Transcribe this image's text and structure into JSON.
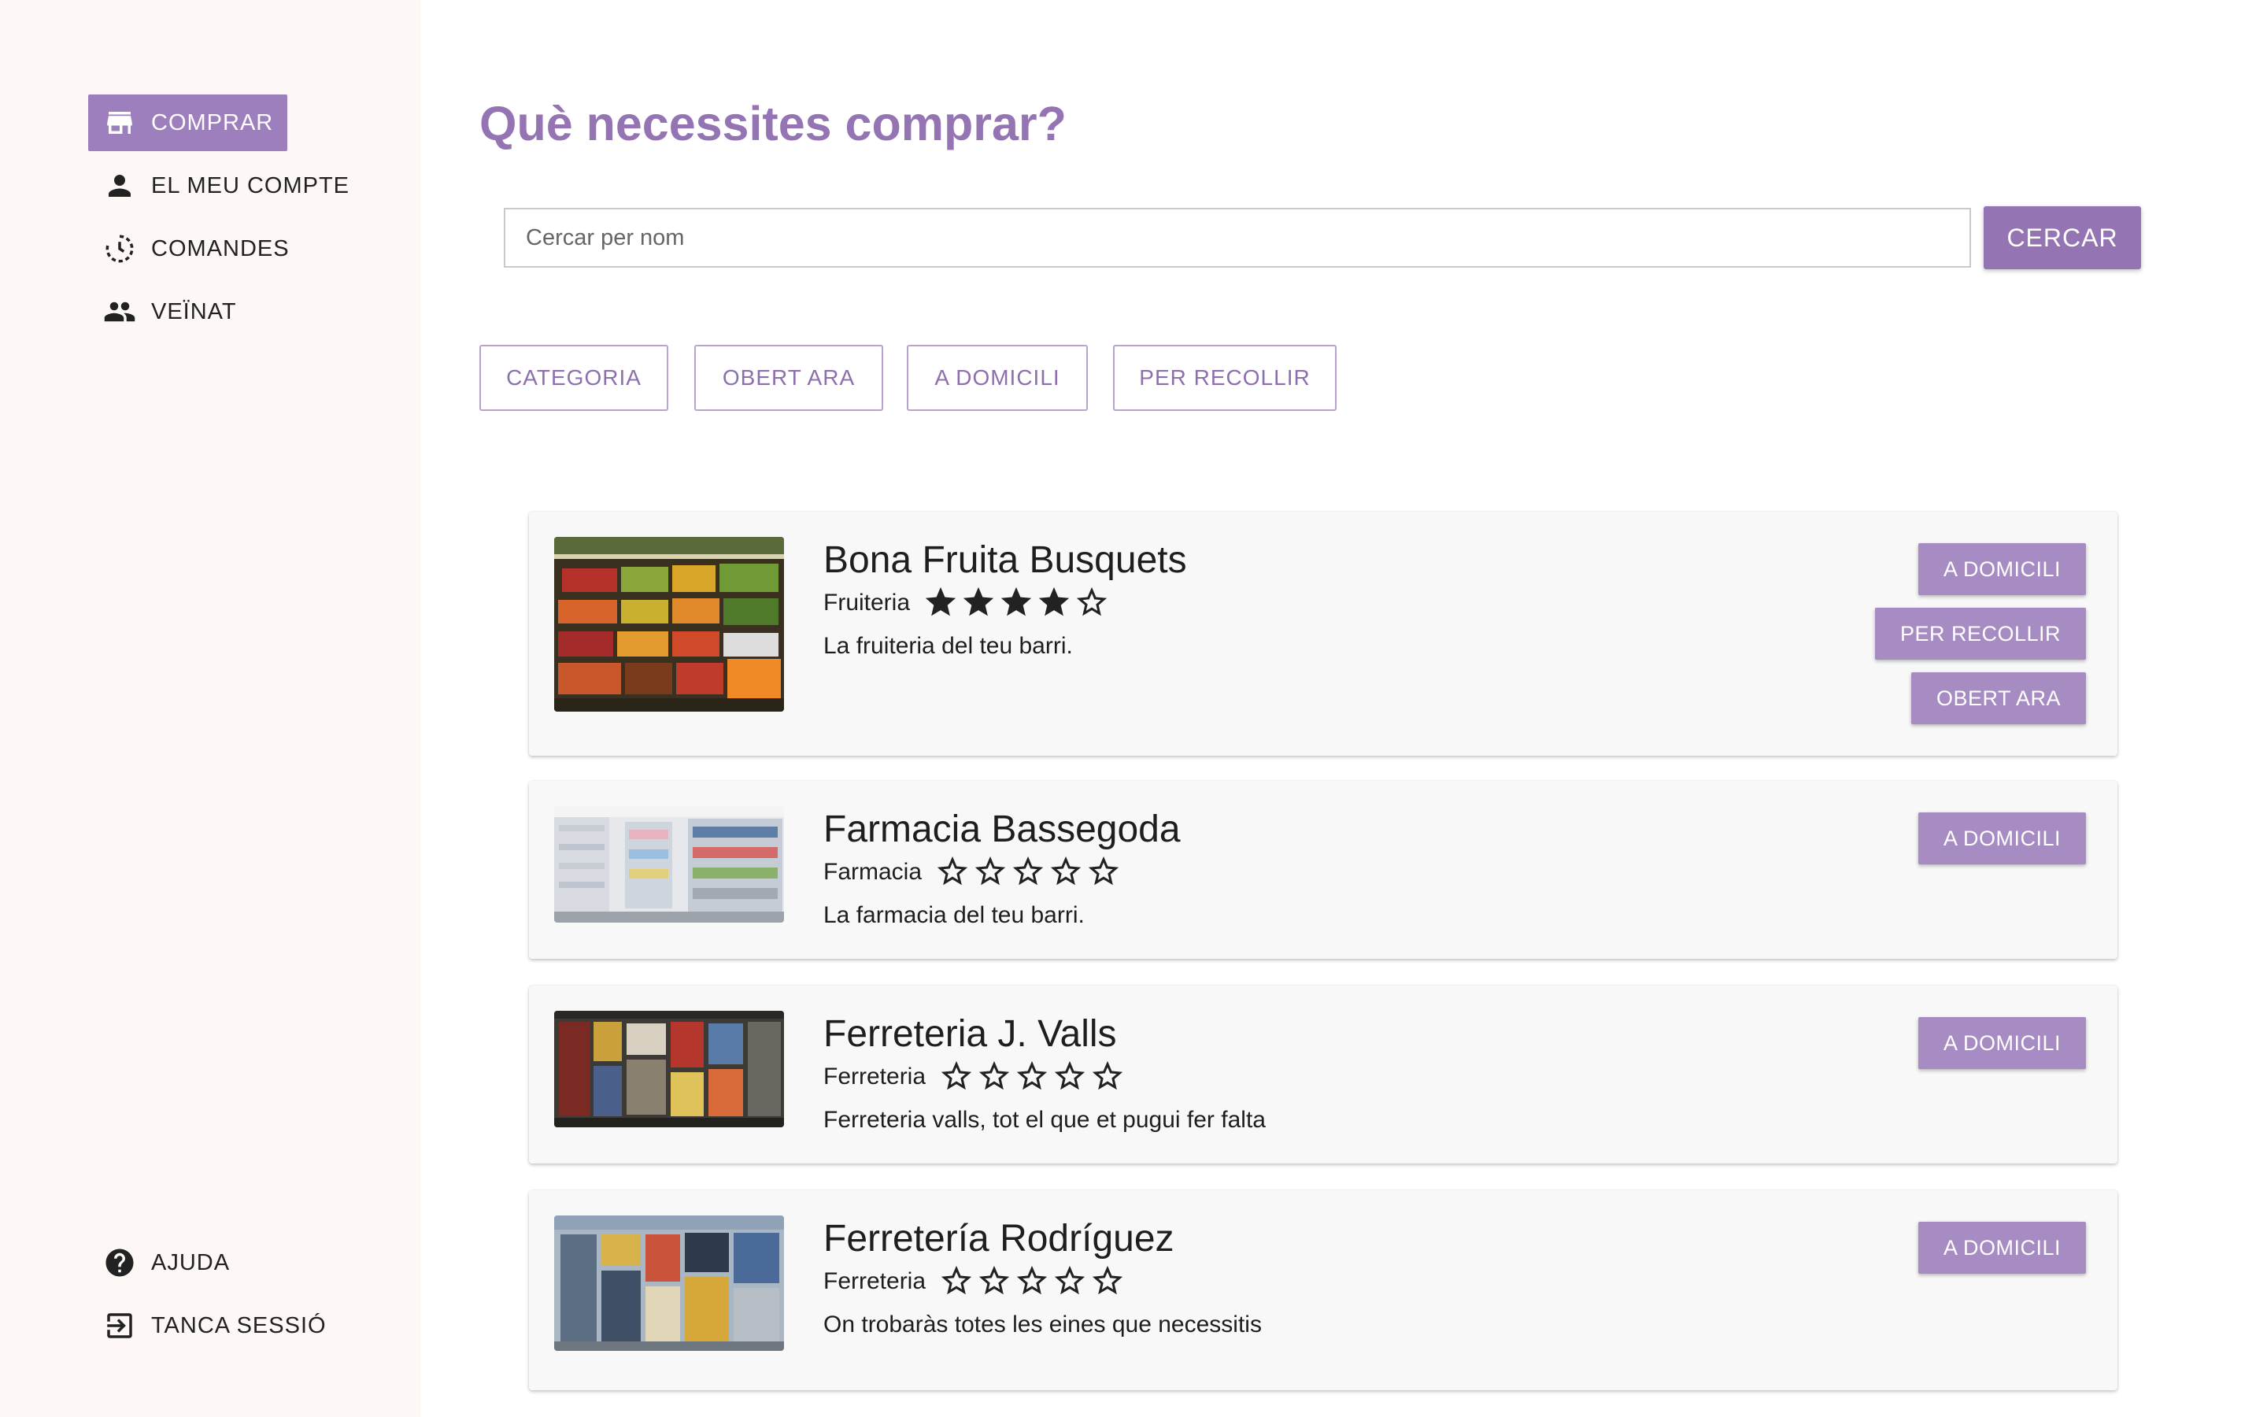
{
  "sidebar": {
    "nav": [
      {
        "label": "COMPRAR",
        "icon": "store-icon",
        "active": true
      },
      {
        "label": "EL MEU COMPTE",
        "icon": "person-icon"
      },
      {
        "label": "COMANDES",
        "icon": "history-icon"
      },
      {
        "label": "VEÏNAT",
        "icon": "people-icon"
      }
    ],
    "bottom": [
      {
        "label": "AJUDA",
        "icon": "help-icon"
      },
      {
        "label": "TANCA SESSIÓ",
        "icon": "logout-icon"
      }
    ]
  },
  "main": {
    "title": "Què necessites comprar?",
    "search": {
      "placeholder": "Cercar per nom",
      "value": "",
      "button": "CERCAR"
    },
    "filters": [
      "CATEGORIA",
      "OBERT ARA",
      "A DOMICILI",
      "PER RECOLLIR"
    ]
  },
  "shops": [
    {
      "name": "Bona Fruita Busquets",
      "category": "Fruiteria",
      "rating": 4,
      "max_rating": 5,
      "description": "La fruiteria del teu barri.",
      "image": "fruit-shop-photo",
      "tags": [
        "A DOMICILI",
        "PER RECOLLIR",
        "OBERT ARA"
      ]
    },
    {
      "name": "Farmacia Bassegoda",
      "category": "Farmacia",
      "rating": 0,
      "max_rating": 5,
      "description": "La farmacia del teu barri.",
      "image": "pharmacy-photo",
      "tags": [
        "A DOMICILI"
      ]
    },
    {
      "name": "Ferreteria J. Valls",
      "category": "Ferreteria",
      "rating": 0,
      "max_rating": 5,
      "description": "Ferreteria valls, tot el que et pugui fer falta",
      "image": "hardware-store-photo",
      "tags": [
        "A DOMICILI"
      ]
    },
    {
      "name": "Ferretería Rodríguez",
      "category": "Ferreteria",
      "rating": 0,
      "max_rating": 5,
      "description": "On trobaràs totes les eines que necessitis",
      "image": "hardware-store-photo",
      "tags": [
        "A DOMICILI"
      ]
    }
  ],
  "colors": {
    "accent": "#9474b2",
    "tag": "#a68cc3",
    "sidebar_bg": "#fdf8f6"
  }
}
